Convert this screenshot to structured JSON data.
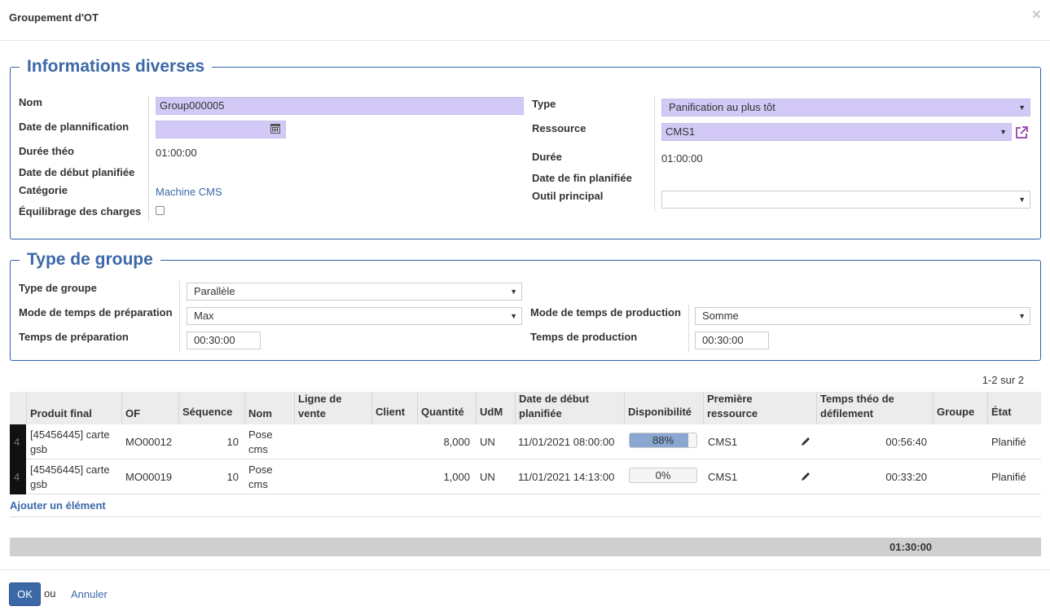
{
  "dialog": {
    "title": "Groupement d'OT",
    "close_glyph": "×"
  },
  "section1": {
    "legend": "Informations diverses",
    "nom": {
      "label": "Nom",
      "value": "Group000005"
    },
    "date_plan": {
      "label": "Date de plannification",
      "value": ""
    },
    "duree_theo": {
      "label": "Durée théo",
      "value": "01:00:00"
    },
    "date_debut": {
      "label": "Date de début planifiée",
      "value": ""
    },
    "categorie": {
      "label": "Catégorie",
      "value": "Machine CMS"
    },
    "equilibrage": {
      "label": "Équilibrage des charges",
      "checked": false
    },
    "type": {
      "label": "Type",
      "value": "Panification au plus tôt"
    },
    "ressource": {
      "label": "Ressource",
      "value": "CMS1"
    },
    "duree": {
      "label": "Durée",
      "value": "01:00:00"
    },
    "date_fin": {
      "label": "Date de fin planifiée",
      "value": ""
    },
    "outil": {
      "label": "Outil principal",
      "value": ""
    }
  },
  "section2": {
    "legend": "Type de groupe",
    "type_groupe": {
      "label": "Type de groupe",
      "value": "Parallèle"
    },
    "mode_prep": {
      "label": "Mode de temps de préparation",
      "value": "Max"
    },
    "temps_prep": {
      "label": "Temps de préparation",
      "value": "00:30:00"
    },
    "mode_prod": {
      "label": "Mode de temps de production",
      "value": "Somme"
    },
    "temps_prod": {
      "label": "Temps de production",
      "value": "00:30:00"
    }
  },
  "pager": "1-2 sur 2",
  "table": {
    "headers": {
      "produit": "Produit final",
      "of": "OF",
      "sequence": "Séquence",
      "nom": "Nom",
      "ligne_l1": "Ligne de",
      "ligne_l2": "vente",
      "client": "Client",
      "quantite": "Quantité",
      "udm": "UdM",
      "date_l1": "Date de début",
      "date_l2": "planifiée",
      "dispo": "Disponibilité",
      "ressource_l1": "Première",
      "ressource_l2": "ressource",
      "temps_l1": "Temps théo de",
      "temps_l2": "défilement",
      "groupe": "Groupe",
      "etat": "État"
    },
    "rows": [
      {
        "handle": "4",
        "produit_l1": "[45456445] carte",
        "produit_l2": "gsb",
        "of": "MO00012",
        "sequence": "10",
        "nom_l1": "Pose",
        "nom_l2": "cms",
        "quantite": "8,000",
        "udm": "UN",
        "date": "11/01/2021 08:00:00",
        "dispo_label": "88%",
        "dispo_percent": 88,
        "ressource": "CMS1",
        "temps": "00:56:40",
        "etat": "Planifié"
      },
      {
        "handle": "4",
        "produit_l1": "[45456445] carte",
        "produit_l2": "gsb",
        "of": "MO00019",
        "sequence": "10",
        "nom_l1": "Pose",
        "nom_l2": "cms",
        "quantite": "1,000",
        "udm": "UN",
        "date": "11/01/2021 14:13:00",
        "dispo_label": "0%",
        "dispo_percent": 0,
        "ressource": "CMS1",
        "temps": "00:33:20",
        "etat": "Planifié"
      }
    ],
    "add_line": "Ajouter un élément",
    "total": "01:30:00"
  },
  "footer": {
    "ok": "OK",
    "or": "ou",
    "cancel": "Annuler"
  },
  "colors": {
    "accent": "#3c68a8",
    "required_field": "#d3c9f7",
    "progress_fill": "#8aa7d1"
  }
}
